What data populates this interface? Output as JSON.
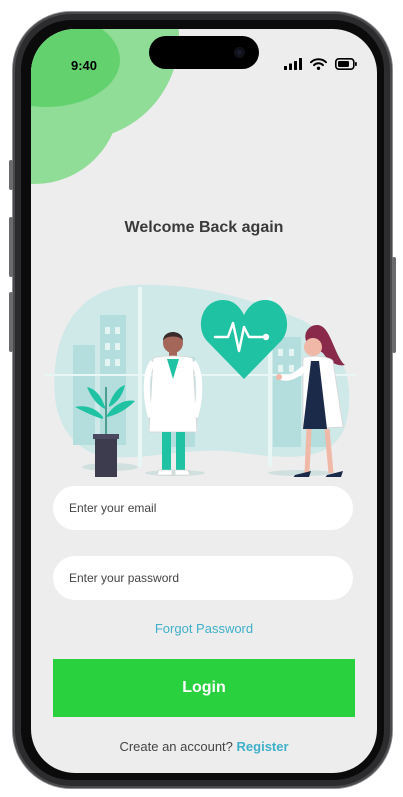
{
  "status_bar": {
    "time": "9:40"
  },
  "login": {
    "title": "Welcome Back again",
    "email_placeholder": "Enter your email",
    "password_placeholder": "Enter your password",
    "forgot_label": "Forgot Password",
    "login_label": "Login",
    "create_prompt": "Create an account?",
    "register_label": "Register"
  },
  "colors": {
    "accent_green": "#29d13f",
    "link_blue": "#3fb0c9",
    "illustration_teal": "#1fc3a3",
    "screen_bg": "#ededed"
  },
  "icons": [
    "signal-icon",
    "wifi-icon",
    "battery-icon",
    "heart-pulse-icon"
  ]
}
